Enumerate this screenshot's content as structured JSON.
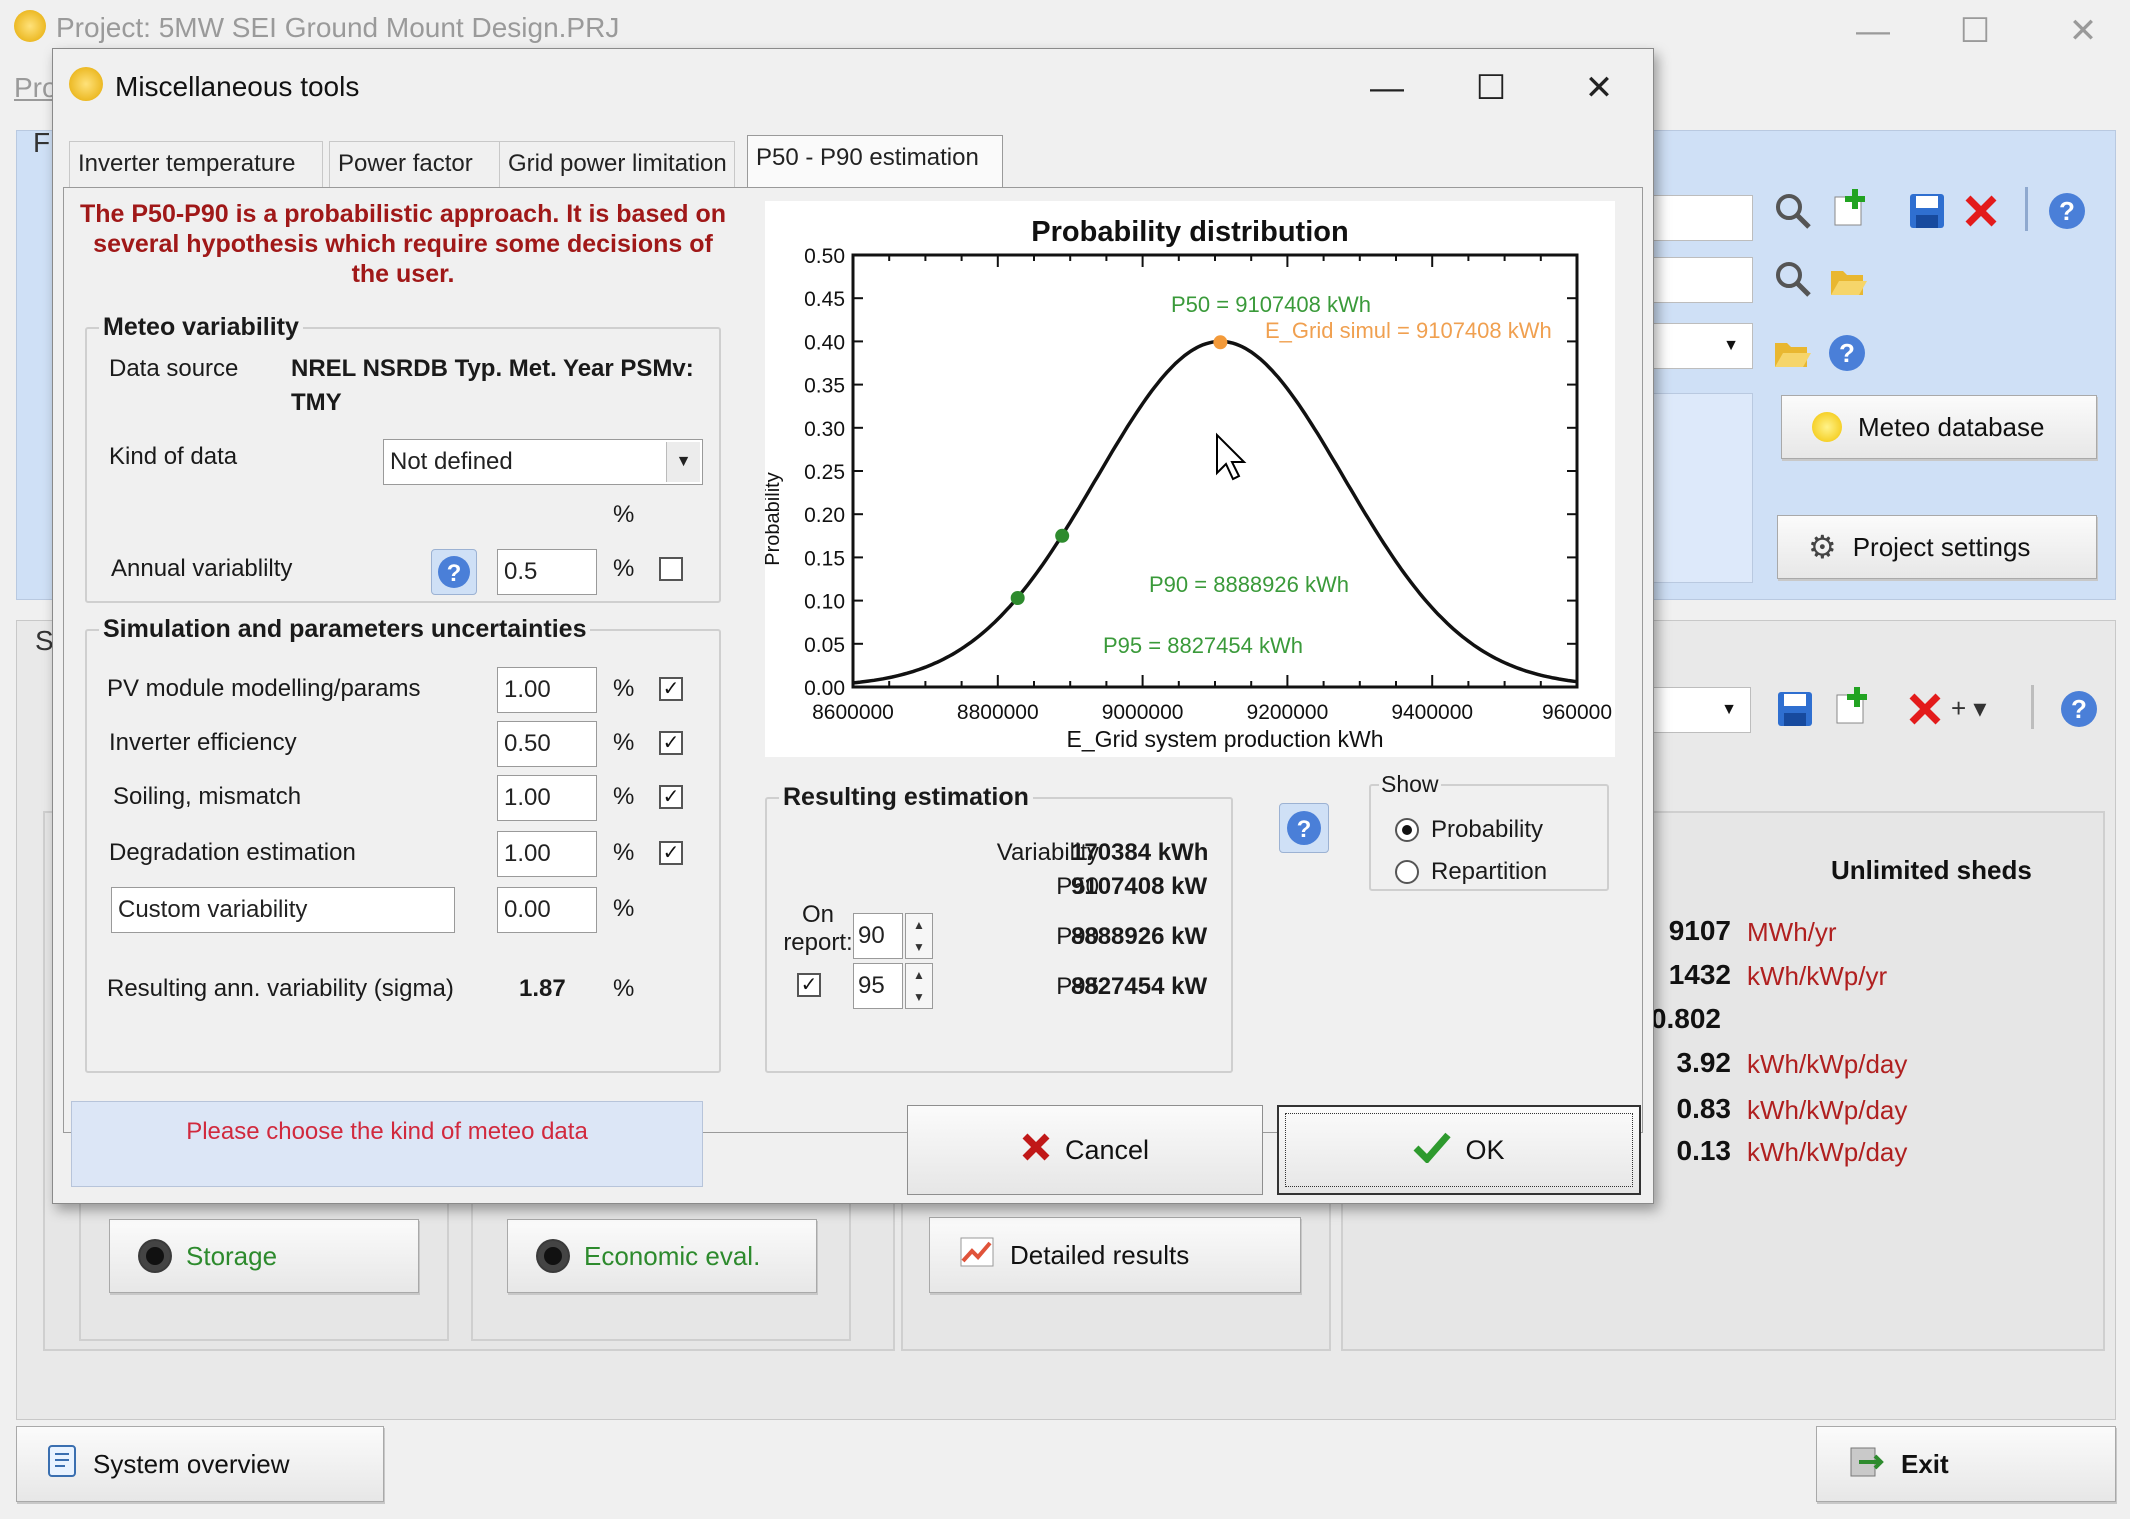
{
  "main": {
    "title": "Project:  5MW SEI Ground Mount Design.PRJ",
    "menu_stub": "Pro",
    "top_letter": "F",
    "mid_letter": "S",
    "meteo_database": "Meteo database",
    "project_settings": "Project settings",
    "results": {
      "header": "Unlimited sheds",
      "rows": [
        {
          "value": "9107",
          "unit": "MWh/yr"
        },
        {
          "value": "1432",
          "unit": "kWh/kWp/yr"
        },
        {
          "value": "0.802",
          "unit": ""
        },
        {
          "value": "3.92",
          "unit": "kWh/kWp/day"
        },
        {
          "value": "0.83",
          "unit": "kWh/kWp/day"
        },
        {
          "value": "0.13",
          "unit": "kWh/kWp/day"
        }
      ]
    },
    "storage": "Storage",
    "economic_eval": "Economic eval.",
    "detailed_results": "Detailed results",
    "system_overview": "System overview",
    "exit": "Exit"
  },
  "dialog": {
    "title": "Miscellaneous tools",
    "tabs": [
      "Inverter temperature",
      "Power factor",
      "Grid power limitation",
      "P50 - P90 estimation"
    ],
    "warning": "The P50-P90 is a probabilistic approach. It is based on several hypothesis which require some decisions of the user.",
    "meteo": {
      "legend": "Meteo variability",
      "data_source_label": "Data source",
      "data_source_value_1": "NREL NSRDB Typ. Met. Year PSMv:",
      "data_source_value_2": "TMY",
      "kind_label": "Kind of data",
      "kind_value": "Not defined",
      "pct_header": "%",
      "annual_label": "Annual variablilty",
      "annual_value": "0.5",
      "pct": "%"
    },
    "sim": {
      "legend": "Simulation and parameters uncertainties",
      "rows": [
        {
          "label": "PV module modelling/params",
          "value": "1.00",
          "checked": true
        },
        {
          "label": "Inverter efficiency",
          "value": "0.50",
          "checked": true
        },
        {
          "label": "Soiling, mismatch",
          "value": "1.00",
          "checked": true
        },
        {
          "label": "Degradation estimation",
          "value": "1.00",
          "checked": true
        }
      ],
      "custom_label": "Custom variability",
      "custom_value": "0.00",
      "resulting_label": "Resulting ann. variability (sigma)",
      "resulting_value": "1.87",
      "pct": "%"
    },
    "result": {
      "legend": "Resulting estimation",
      "variability_label": "Variability",
      "variability_value": "170384 kWh",
      "p50_label": "P50",
      "p50_value": "9107408 kW",
      "on_report": "On report:",
      "p90_spin": "90",
      "p90_label": "P90",
      "p90_value": "8888926 kW",
      "p95_spin": "95",
      "p95_label": "P95",
      "p95_value": "8827454 kW"
    },
    "show": {
      "legend": "Show",
      "probability": "Probability",
      "repartition": "Repartition",
      "selected": "probability"
    },
    "message": "Please choose the kind of meteo data",
    "cancel": "Cancel",
    "ok": "OK"
  },
  "chart_data": {
    "type": "line",
    "title": "Probability distribution",
    "xlabel": "E_Grid system production kWh",
    "ylabel": "Probability",
    "xlim": [
      8600000,
      9600000
    ],
    "ylim": [
      0,
      0.5
    ],
    "x_ticks": [
      "8600000",
      "8800000",
      "9000000",
      "9200000",
      "9400000",
      "960000"
    ],
    "y_ticks": [
      "0.00",
      "0.05",
      "0.10",
      "0.15",
      "0.20",
      "0.25",
      "0.30",
      "0.35",
      "0.40",
      "0.45",
      "0.50"
    ],
    "curve": {
      "mean": 9107408,
      "sigma": 170384,
      "peak": 0.4
    },
    "points": [
      {
        "x": 9107408,
        "y": 0.399,
        "color": "#f39a3a"
      },
      {
        "x": 8888926,
        "y": 0.175,
        "color": "#2e8b2e"
      },
      {
        "x": 8827454,
        "y": 0.103,
        "color": "#2e8b2e"
      }
    ],
    "annotations": [
      {
        "text": "P50 = 9107408 kWh",
        "color": "#3a9a3a"
      },
      {
        "text": "E_Grid simul = 9107408 kWh",
        "color": "#f0a050"
      },
      {
        "text": "P90 = 8888926 kWh",
        "color": "#3a9a3a"
      },
      {
        "text": "P95 = 8827454 kWh",
        "color": "#3a9a3a"
      }
    ]
  }
}
